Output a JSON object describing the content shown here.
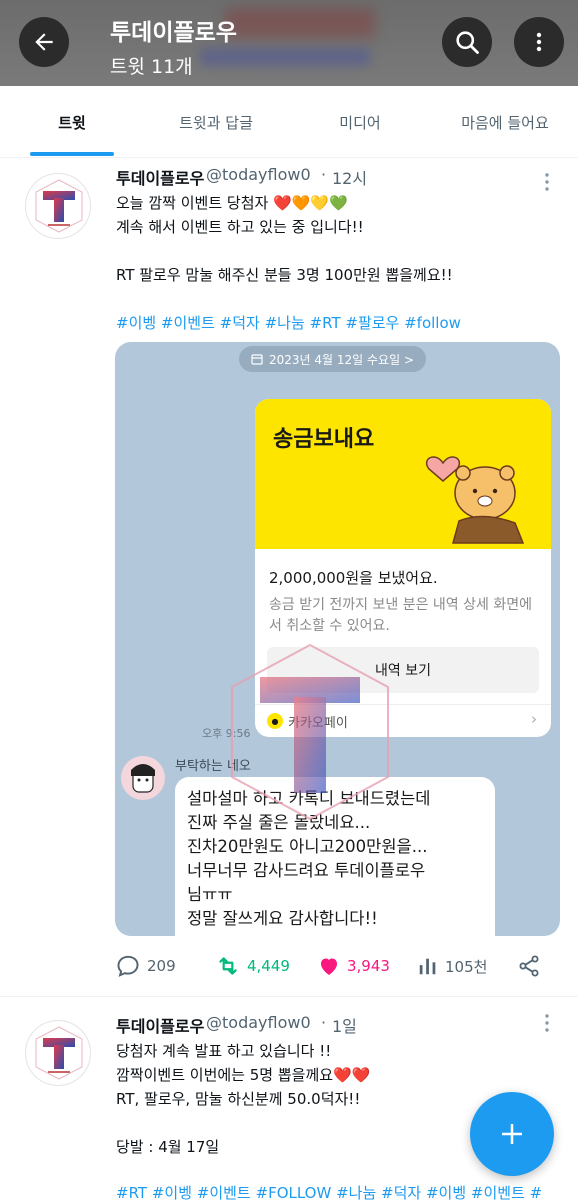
{
  "header": {
    "title": "투데이플로우",
    "subtitle": "트윗 11개",
    "back_icon": "arrow-left-icon",
    "search_icon": "search-icon",
    "more_icon": "more-vertical-icon"
  },
  "tabs": [
    {
      "label": "트윗",
      "active": true
    },
    {
      "label": "트윗과 답글",
      "active": false
    },
    {
      "label": "미디어",
      "active": false
    },
    {
      "label": "마음에 들어요",
      "active": false
    }
  ],
  "tweets": [
    {
      "name": "투데이플로우",
      "handle": "@todayflow0",
      "sep": "·",
      "time": "12시",
      "lines": [
        "오늘 깜짝 이벤트 당첨자 ❤️🧡💛💚",
        "계속 해서 이벤트 하고 있는 중 입니다!!",
        "",
        "RT 팔로우 맘눌 해주신 분들 3명 100만원 뽑을께요!!"
      ],
      "hashtags": "#이벵 #이벤트 #덕자 #나눔 #RT #팔로우 #follow",
      "media": {
        "date_pill": "2023년 4월 12일 수요일 >",
        "card_title": "송금보내요",
        "amount": "2,000,000원을 보냈어요.",
        "description": "송금 받기 전까지 보낸 분은 내역 상세 화면에서 취소할 수 있어요.",
        "button": "내역 보기",
        "brand": "카카오페이",
        "time": "오후 9:56",
        "sender": "부탁하는 네오",
        "message_lines": [
          "설마설마 하고 카톡디 보내드렸는데",
          "진짜 주실 줄은 몰랐네요...",
          "진차20만원도 아니고200만원을...",
          "너무너무 감사드려요 투데이플로우",
          "님ㅠㅠ",
          "",
          "정말 잘쓰게요 감사합니다!!"
        ]
      },
      "actions": {
        "replies": "209",
        "retweets": "4,449",
        "likes": "3,943",
        "views": "105천"
      }
    },
    {
      "name": "투데이플로우",
      "handle": "@todayflow0",
      "sep": "·",
      "time": "1일",
      "lines": [
        "당첨자 계속 발표 하고 있습니다 !!",
        "깜짝이벤트 이번에는 5명 뽑을께요❤️❤️",
        "RT, 팔로우, 맘눌 하신분께 50.0덕자!!",
        "",
        "당발 : 4월 17일"
      ],
      "hashtags": "#RT #이벵 #이벤트 #FOLLOW #나눔 #덕자 #이벵 #이벤트 #"
    }
  ],
  "fab": {
    "icon": "plus-icon"
  },
  "colors": {
    "accent": "#1d9bf0",
    "retweet": "#00ba7c",
    "like": "#f91880",
    "kakao": "#fee500"
  }
}
